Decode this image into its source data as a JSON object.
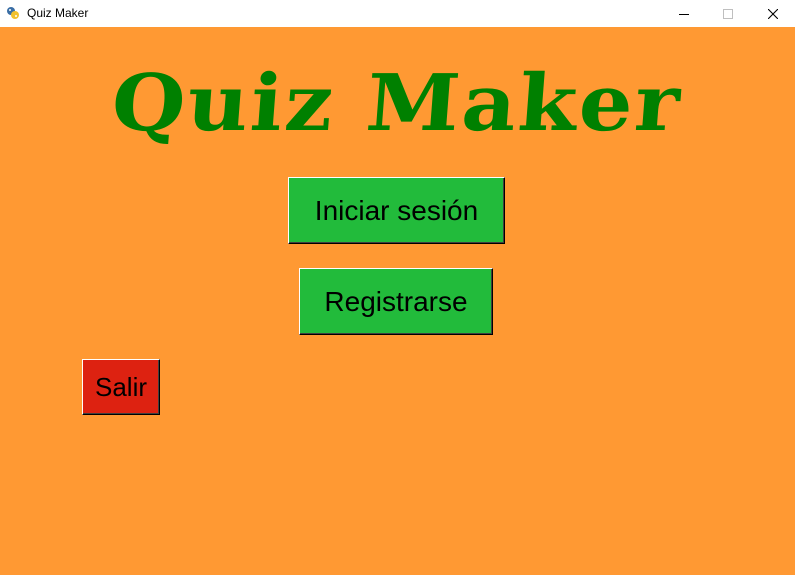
{
  "window": {
    "title": "Quiz Maker",
    "icon": "python-app-icon"
  },
  "colors": {
    "background": "#FF9933",
    "logo": "#008000",
    "primary_button": "#22BB3B",
    "exit_button": "#DD2211"
  },
  "main": {
    "logo_text": "Quiz Maker",
    "login_label": "Iniciar sesión",
    "register_label": "Registrarse",
    "exit_label": "Salir"
  }
}
